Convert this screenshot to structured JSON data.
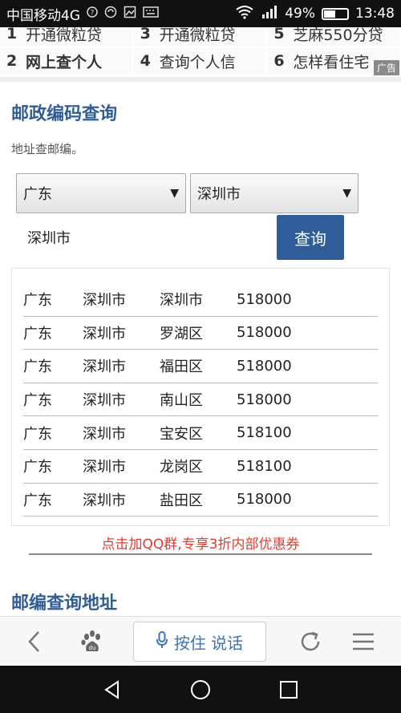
{
  "status_bar": {
    "carrier": "中国移动4G",
    "battery_percent": "49%",
    "battery_level": 0.49,
    "time": "13:48",
    "network_label": "4G"
  },
  "ad_grid": {
    "rows": [
      [
        {
          "num": "1",
          "text": "开通微粒贷"
        },
        {
          "num": "3",
          "text": "开通微粒贷"
        },
        {
          "num": "5",
          "text": "芝麻550分贷"
        }
      ],
      [
        {
          "num": "2",
          "text": "网上查个人"
        },
        {
          "num": "4",
          "text": "查询个人信"
        },
        {
          "num": "6",
          "text": "怎样看住宅"
        }
      ]
    ],
    "badge": "广告"
  },
  "main": {
    "title": "邮政编码查询",
    "subtitle": "地址查邮编。",
    "province_select": "广东",
    "city_select": "深圳市",
    "address_input_value": "深圳市",
    "query_button": "查询",
    "results": [
      [
        "广东",
        "深圳市",
        "深圳市",
        "518000"
      ],
      [
        "广东",
        "深圳市",
        "罗湖区",
        "518000"
      ],
      [
        "广东",
        "深圳市",
        "福田区",
        "518000"
      ],
      [
        "广东",
        "深圳市",
        "南山区",
        "518000"
      ],
      [
        "广东",
        "深圳市",
        "宝安区",
        "518100"
      ],
      [
        "广东",
        "深圳市",
        "龙岗区",
        "518100"
      ],
      [
        "广东",
        "深圳市",
        "盐田区",
        "518000"
      ]
    ],
    "promo_link": "点击加QQ群,专享3折内部优惠券",
    "section2_title": "邮编查询地址"
  },
  "toolbar": {
    "voice_label": "按住 说话"
  },
  "colors": {
    "accent": "#2e5d98",
    "promo": "#e53b2c",
    "voice": "#3d73bd"
  },
  "icons": {
    "back": "chevron-left-icon",
    "baidu": "baidu-paw-icon",
    "mic": "microphone-icon",
    "refresh": "refresh-icon",
    "menu": "hamburger-menu-icon"
  }
}
